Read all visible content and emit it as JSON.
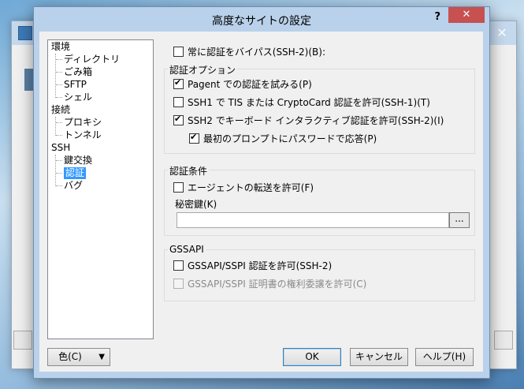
{
  "dialog": {
    "title": "高度なサイトの設定",
    "help_glyph": "?",
    "close_glyph": "✕"
  },
  "background_window": {
    "close_glyph": "✕"
  },
  "tree": {
    "env": "環境",
    "dir": "ディレクトリ",
    "trash": "ごみ箱",
    "sftp": "SFTP",
    "shell": "シェル",
    "conn": "接続",
    "proxy": "プロキシ",
    "tunnel": "トンネル",
    "ssh": "SSH",
    "kex": "鍵交換",
    "auth": "認証",
    "bug": "バグ"
  },
  "bypass": {
    "label": "常に認証をバイパス(SSH-2)(B):",
    "checked": false
  },
  "auth_options": {
    "title": "認証オプション",
    "pageant": {
      "label": "Pagent での認証を試みる(P)",
      "checked": true
    },
    "tis": {
      "label": "SSH1 で TIS または CryptoCard 認証を許可(SSH-1)(T)",
      "checked": false
    },
    "kbdint": {
      "label": "SSH2 でキーボード インタラクティブ認証を許可(SSH-2)(I)",
      "checked": true
    },
    "first_prompt": {
      "label": "最初のプロンプトにパスワードで応答(P)",
      "checked": true
    }
  },
  "auth_params": {
    "title": "認証条件",
    "agent_fwd": {
      "label": "エージェントの転送を許可(F)",
      "checked": false
    },
    "private_key_label": "秘密鍵(K)",
    "private_key_value": "",
    "browse_label": "..."
  },
  "gssapi": {
    "title": "GSSAPI",
    "allow": {
      "label": "GSSAPI/SSPI 認証を許可(SSH-2)",
      "checked": false
    },
    "delegate": {
      "label": "GSSAPI/SSPI 証明書の権利委譲を許可(C)",
      "checked": false,
      "disabled": true
    }
  },
  "buttons": {
    "color": "色(C)",
    "color_arrow": "▼",
    "ok": "OK",
    "cancel": "キャンセル",
    "help": "ヘルプ(H)"
  },
  "colors": {
    "titlebar": "#b9d1ea",
    "close": "#c75050",
    "selection": "#3399ff"
  }
}
